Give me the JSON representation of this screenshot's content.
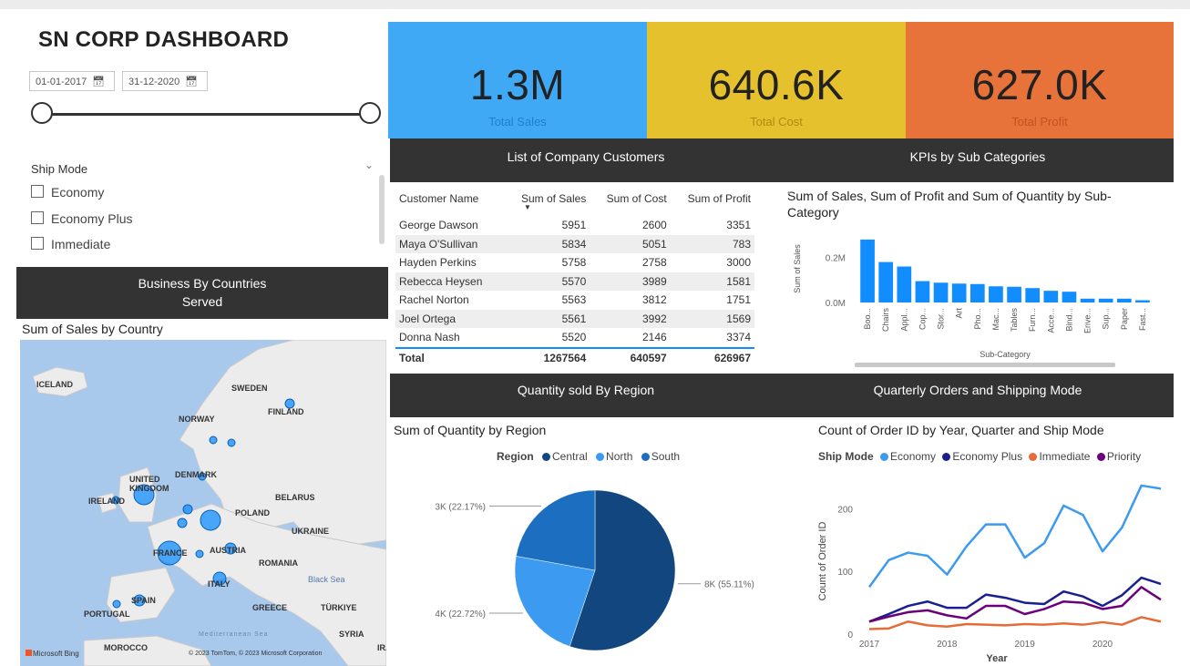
{
  "header": {
    "title": "SN CORP DASHBOARD"
  },
  "date_range": {
    "start": "01-01-2017",
    "end": "31-12-2020"
  },
  "ship_mode_filter": {
    "label": "Ship Mode",
    "options": [
      "Economy",
      "Economy Plus",
      "Immediate"
    ]
  },
  "sections": {
    "countries": [
      "Business By Countries",
      "Served"
    ],
    "customers": "List of Company Customers",
    "kpis_sub": "KPIs by Sub Categories",
    "region": "Quantity sold By Region",
    "quarterly": "Quarterly Orders and Shipping Mode"
  },
  "kpis": [
    {
      "value": "1.3M",
      "label": "Total Sales",
      "color": "#3fa9f5"
    },
    {
      "value": "640.6K",
      "label": "Total Cost",
      "color": "#e6c12e"
    },
    {
      "value": "627.0K",
      "label": "Total Profit",
      "color": "#e8733a"
    }
  ],
  "customers_table": {
    "columns": [
      "Customer Name",
      "Sum of Sales",
      "Sum of Cost",
      "Sum of Profit"
    ],
    "rows": [
      [
        "George Dawson",
        "5951",
        "2600",
        "3351"
      ],
      [
        "Maya O'Sullivan",
        "5834",
        "5051",
        "783"
      ],
      [
        "Hayden Perkins",
        "5758",
        "2758",
        "3000"
      ],
      [
        "Rebecca Heysen",
        "5570",
        "3989",
        "1581"
      ],
      [
        "Rachel Norton",
        "5563",
        "3812",
        "1751"
      ],
      [
        "Joel Ortega",
        "5561",
        "3992",
        "1569"
      ],
      [
        "Donna Nash",
        "5520",
        "2146",
        "3374"
      ]
    ],
    "total": [
      "Total",
      "1267564",
      "640597",
      "626967"
    ]
  },
  "map": {
    "title": "Sum of Sales by Country",
    "labels": [
      "ICELAND",
      "SWEDEN",
      "FINLAND",
      "NORWAY",
      "UNITED KINGDOM",
      "DENMARK",
      "IRELAND",
      "BELARUS",
      "POLAND",
      "UKRAINE",
      "FRANCE",
      "AUSTRIA",
      "ROMANIA",
      "Black Sea",
      "ITALY",
      "SPAIN",
      "PORTUGAL",
      "GREECE",
      "TÜRKIYE",
      "SYRIA",
      "MOROCCO",
      "IRA",
      "Mediterranean Sea"
    ],
    "attribution": "© 2023 TomTom, © 2023 Microsoft Corporation",
    "brand": "Microsoft Bing"
  },
  "chart_data": [
    {
      "type": "bar",
      "title": "Sum of Sales, Sum of Profit and Sum of Quantity by Sub-Category",
      "xlabel": "Sub-Category",
      "ylabel": "Sum of Sales",
      "categories": [
        "Boo...",
        "Chairs",
        "Appl...",
        "Cop...",
        "Stor...",
        "Art",
        "Pho...",
        "Mac...",
        "Tables",
        "Furn...",
        "Acce...",
        "Bind...",
        "Enve...",
        "Sup...",
        "Paper",
        "Fast..."
      ],
      "values": [
        280000,
        180000,
        160000,
        95000,
        88000,
        84000,
        82000,
        72000,
        70000,
        64000,
        52000,
        48000,
        17000,
        17000,
        17000,
        10000
      ],
      "yticks": [
        "0.0M",
        "0.2M"
      ],
      "ylim": [
        0,
        300000
      ],
      "color": "#118dff"
    },
    {
      "type": "pie",
      "title": "Sum of Quantity by Region",
      "legend_title": "Region",
      "slices": [
        {
          "name": "Central",
          "value": 55.11,
          "label": "8K (55.11%)",
          "color": "#12467e"
        },
        {
          "name": "North",
          "value": 22.72,
          "label": "4K (22.72%)",
          "color": "#3c9bf0"
        },
        {
          "name": "South",
          "value": 22.17,
          "label": "3K (22.17%)",
          "color": "#1c6ec0"
        }
      ]
    },
    {
      "type": "line",
      "title": "Count of Order ID by Year, Quarter and Ship Mode",
      "legend_title": "Ship Mode",
      "xlabel": "Year",
      "ylabel": "Count of Order ID",
      "x": [
        "2017 Q1",
        "2017 Q2",
        "2017 Q3",
        "2017 Q4",
        "2018 Q1",
        "2018 Q2",
        "2018 Q3",
        "2018 Q4",
        "2019 Q1",
        "2019 Q2",
        "2019 Q3",
        "2019 Q4",
        "2020 Q1",
        "2020 Q2",
        "2020 Q3",
        "2020 Q4"
      ],
      "xticks": [
        "2017",
        "2018",
        "2019",
        "2020"
      ],
      "yticks": [
        0,
        100,
        200
      ],
      "ylim": [
        0,
        250
      ],
      "series": [
        {
          "name": "Economy",
          "color": "#3c9bf0",
          "values": [
            75,
            118,
            130,
            125,
            95,
            140,
            175,
            175,
            122,
            145,
            205,
            190,
            132,
            170,
            237,
            232
          ]
        },
        {
          "name": "Economy Plus",
          "color": "#1a1f8f",
          "values": [
            20,
            32,
            45,
            52,
            42,
            42,
            63,
            58,
            50,
            48,
            68,
            60,
            45,
            62,
            90,
            80
          ]
        },
        {
          "name": "Immediate",
          "color": "#e66c37",
          "values": [
            8,
            9,
            20,
            14,
            12,
            16,
            15,
            14,
            16,
            15,
            17,
            15,
            19,
            15,
            27,
            20
          ]
        },
        {
          "name": "Priority",
          "color": "#6b007b",
          "values": [
            20,
            28,
            35,
            38,
            30,
            25,
            45,
            45,
            32,
            40,
            52,
            50,
            40,
            45,
            75,
            55
          ]
        }
      ]
    }
  ]
}
